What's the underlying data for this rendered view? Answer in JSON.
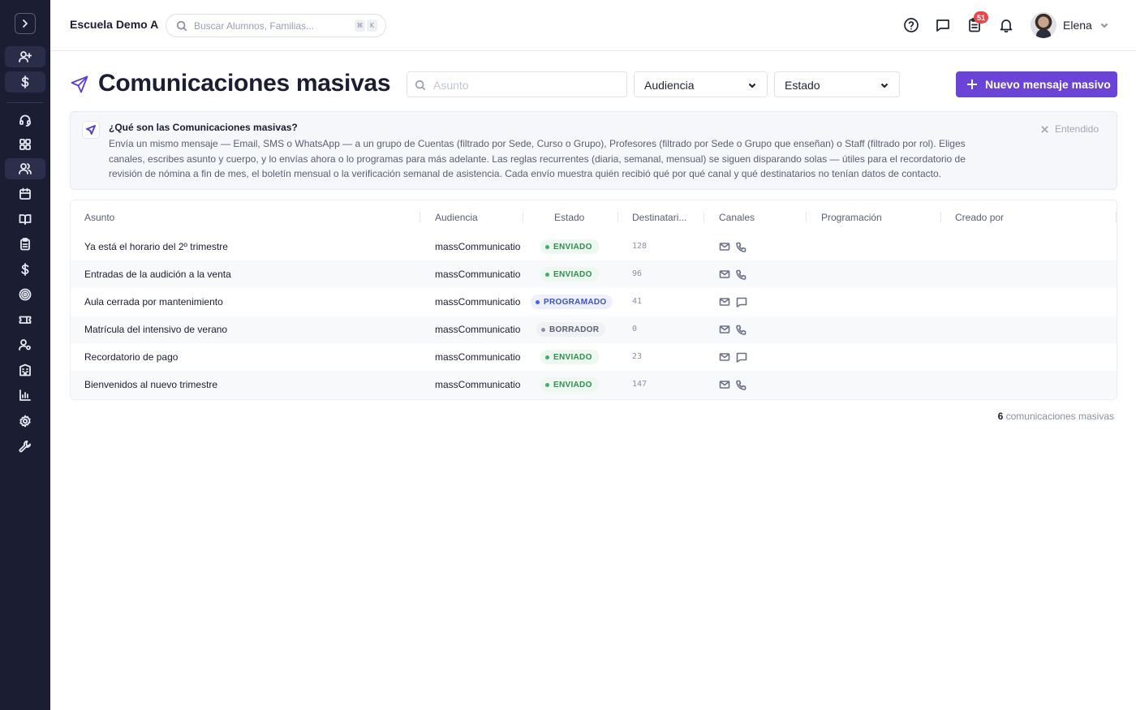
{
  "header": {
    "school_name": "Escuela Demo A",
    "search_placeholder": "Buscar Alumnos, Familias...",
    "search_shortcut": [
      "⌘",
      "K"
    ],
    "notification_count": "51",
    "user_name": "Elena"
  },
  "sidebar": {
    "icons": [
      "chevron-right-icon",
      "user-plus-icon",
      "dollar-icon",
      "headset-icon",
      "grid-icon",
      "users-icon",
      "calendar-icon",
      "book-icon",
      "clipboard-icon",
      "dollar-icon",
      "target-icon",
      "ticket-icon",
      "user-gear-icon",
      "building-icon",
      "bar-chart-icon",
      "gear-icon",
      "wrench-icon"
    ]
  },
  "page": {
    "title": "Comunicaciones masivas",
    "subject_placeholder": "Asunto",
    "audience_filter": "Audiencia",
    "status_filter": "Estado",
    "new_button": "Nuevo mensaje masivo"
  },
  "info": {
    "title": "¿Qué son las Comunicaciones masivas?",
    "body": "Envía un mismo mensaje — Email, SMS o WhatsApp — a un grupo de Cuentas (filtrado por Sede, Curso o Grupo), Profesores (filtrado por Sede o Grupo que enseñan) o Staff (filtrado por rol). Eliges canales, escribes asunto y cuerpo, y lo envías ahora o lo programas para más adelante. Las reglas recurrentes (diaria, semanal, mensual) se siguen disparando solas — útiles para el recordatorio de revisión de nómina a fin de mes, el boletín mensual o la verificación semanal de asistencia. Cada envío muestra quién recibió qué por qué canal y qué destinatarios no tenían datos de contacto.",
    "dismiss": "Entendido"
  },
  "table": {
    "columns": [
      "Asunto",
      "Audiencia",
      "Estado",
      "Destinatari...",
      "Canales",
      "Programación",
      "Creado por"
    ],
    "rows": [
      {
        "subject": "Ya está el horario del 2º trimestre",
        "audience": "massCommunicatio",
        "status": "ENVIADO",
        "recipients": "128",
        "channels": [
          "mail-icon",
          "phone-icon"
        ]
      },
      {
        "subject": "Entradas de la audición a la venta",
        "audience": "massCommunicatio",
        "status": "ENVIADO",
        "recipients": "96",
        "channels": [
          "mail-icon",
          "phone-icon"
        ]
      },
      {
        "subject": "Aula cerrada por mantenimiento",
        "audience": "massCommunicatio",
        "status": "PROGRAMADO",
        "recipients": "41",
        "channels": [
          "mail-icon",
          "message-icon"
        ]
      },
      {
        "subject": "Matrícula del intensivo de verano",
        "audience": "massCommunicatio",
        "status": "BORRADOR",
        "recipients": "0",
        "channels": [
          "mail-icon",
          "phone-icon"
        ]
      },
      {
        "subject": "Recordatorio de pago",
        "audience": "massCommunicatio",
        "status": "ENVIADO",
        "recipients": "23",
        "channels": [
          "mail-icon",
          "message-icon"
        ]
      },
      {
        "subject": "Bienvenidos al nuevo trimestre",
        "audience": "massCommunicatio",
        "status": "ENVIADO",
        "recipients": "147",
        "channels": [
          "mail-icon",
          "phone-icon"
        ]
      }
    ]
  },
  "footer": {
    "count": "6",
    "count_label": "comunicaciones masivas"
  },
  "colors": {
    "sidebar_bg": "#1b1d33",
    "accent": "#6a44d6",
    "sent": "#2f8f4f",
    "scheduled": "#3953c4",
    "draft": "#5a6072",
    "badge": "#e5484d"
  }
}
